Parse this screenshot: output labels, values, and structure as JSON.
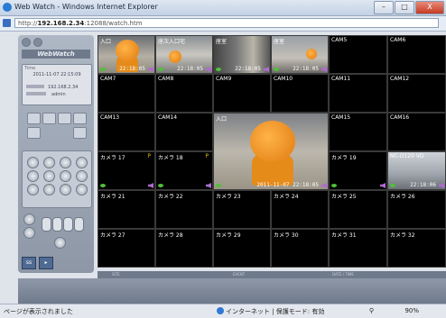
{
  "window": {
    "title": "Web Watch - Windows Internet Explorer",
    "minimize": "–",
    "maximize": "□",
    "close": "X"
  },
  "address": {
    "prefix": "http://",
    "host": "192.168.2.34",
    "rest": ":12088/watch.htm"
  },
  "sidebar": {
    "logo": "WebWatch",
    "info_header": "Time",
    "datetime": "2011-11-07 22:15:09",
    "ip": "192.168.2.34",
    "user": "admin"
  },
  "cameras": {
    "row1": [
      "入口",
      "座次入口宅",
      "座室",
      "座室",
      "CAM5",
      "CAM6"
    ],
    "row1_ts": [
      "22:18:05",
      "22:18:05",
      "22:18:05",
      "22:18:05"
    ],
    "row2": [
      "CAM7",
      "CAM8",
      "CAM9",
      "CAM10",
      "CAM11",
      "CAM12"
    ],
    "row3": [
      "CAM13",
      "CAM14",
      "入口",
      "CAM15",
      "CAM16"
    ],
    "big_ts": "2011-11-07 22:18:05",
    "row4": [
      "カメラ 17",
      "カメラ 18",
      "カメラ 19",
      "NC-D120 VD"
    ],
    "row4_flag": "P",
    "row4_ts": "22:18:06",
    "row5": [
      "カメラ 21",
      "カメラ 22",
      "カメラ 23",
      "カメラ 24",
      "カメラ 25",
      "カメラ 26"
    ],
    "row6": [
      "カメラ 27",
      "カメラ 28",
      "カメラ 29",
      "カメラ 30",
      "カメラ 31",
      "カメラ 32"
    ]
  },
  "event_bar": {
    "col1": "SITE",
    "col2": "EVENT",
    "col3": "DATE / TIME"
  },
  "statusbar": {
    "left": "ページが表示されました",
    "zone": "インターネット | 保護モード: 有効",
    "zoom": "90%"
  }
}
